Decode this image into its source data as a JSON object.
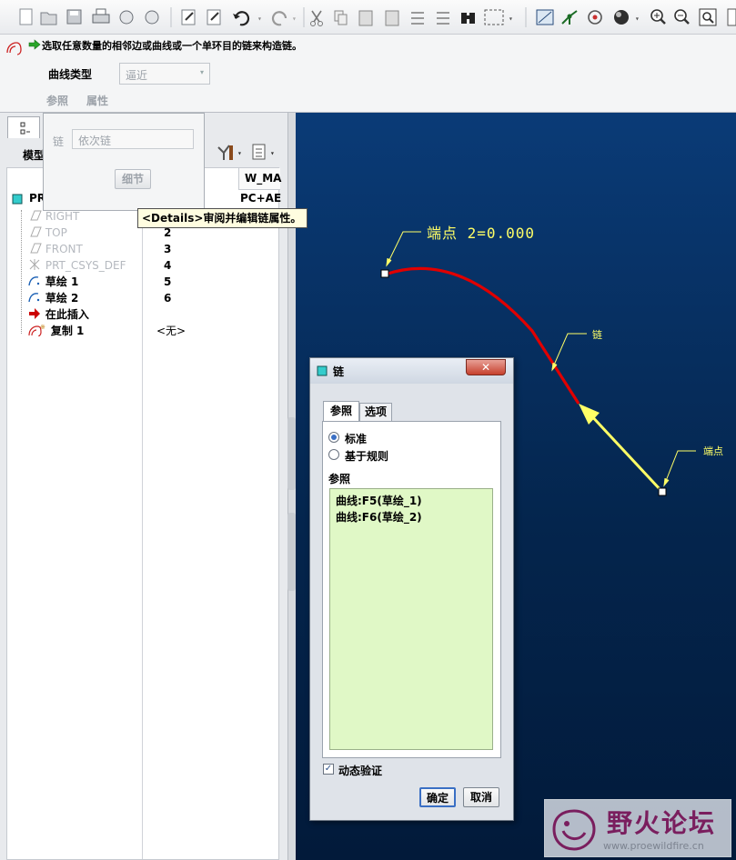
{
  "toolbar": {
    "icons": [
      "new-file-icon",
      "open-folder-icon",
      "save-icon",
      "print-icon",
      "mail-icon",
      "mail-attach-icon",
      "regenerate-icon",
      "regen-manager-icon",
      "undo-icon",
      "redo-icon",
      "cut-icon",
      "copy-icon",
      "paste-icon",
      "paste-special-icon",
      "relations-icon",
      "relations2-icon",
      "find-icon",
      "select-box-icon",
      "view-icon",
      "datum-axis-icon",
      "settings-icon",
      "shading-icon",
      "zoom-in-icon",
      "zoom-out-icon",
      "refit-icon"
    ]
  },
  "dashboard": {
    "prompt": "选取任意数量的相邻边或曲线或一个单环目的链来构造链。",
    "curve_type_label": "曲线类型",
    "curve_type_value": "逼近",
    "tab_references": "参照",
    "tab_properties": "属性"
  },
  "popup": {
    "chain_label": "链",
    "chain_placeholder": "依次链",
    "details_button": "细节"
  },
  "tooltip": "<Details>审阅并编辑链属性。",
  "model_tree": {
    "tab_label": "模型",
    "column2_header": "W_MA",
    "root_label": "PR",
    "root_value": "PC+AE",
    "rows": [
      {
        "label": "RIGHT",
        "value": "",
        "icon": "datum-plane-icon"
      },
      {
        "label": "TOP",
        "value": "2",
        "icon": "datum-plane-icon"
      },
      {
        "label": "FRONT",
        "value": "3",
        "icon": "datum-plane-icon"
      },
      {
        "label": "PRT_CSYS_DEF",
        "value": "4",
        "icon": "csys-icon"
      },
      {
        "label": "草绘 1",
        "value": "5",
        "icon": "sketch-icon"
      },
      {
        "label": "草绘 2",
        "value": "6",
        "icon": "sketch-icon"
      },
      {
        "label": "在此插入",
        "value": "",
        "icon": "insert-arrow-icon"
      },
      {
        "label": "复制 1",
        "value": "<无>",
        "icon": "copy-feature-icon"
      }
    ]
  },
  "viewport": {
    "annotation_endpoint_value": "端点 2=0.000",
    "annotation_chain": "链",
    "annotation_endpoint": "端点"
  },
  "dialog": {
    "title": "链",
    "close": "✕",
    "tab_references": "参照",
    "tab_options": "选项",
    "radio_standard": "标准",
    "radio_rule_based": "基于规则",
    "references_label": "参照",
    "references": [
      "曲线:F5(草绘_1)",
      "曲线:F6(草绘_2)"
    ],
    "dynamic_validation": "动态验证",
    "ok": "确定",
    "cancel": "取消"
  },
  "watermark": {
    "title": "野火论坛",
    "url": "www.proewildfire.cn"
  }
}
